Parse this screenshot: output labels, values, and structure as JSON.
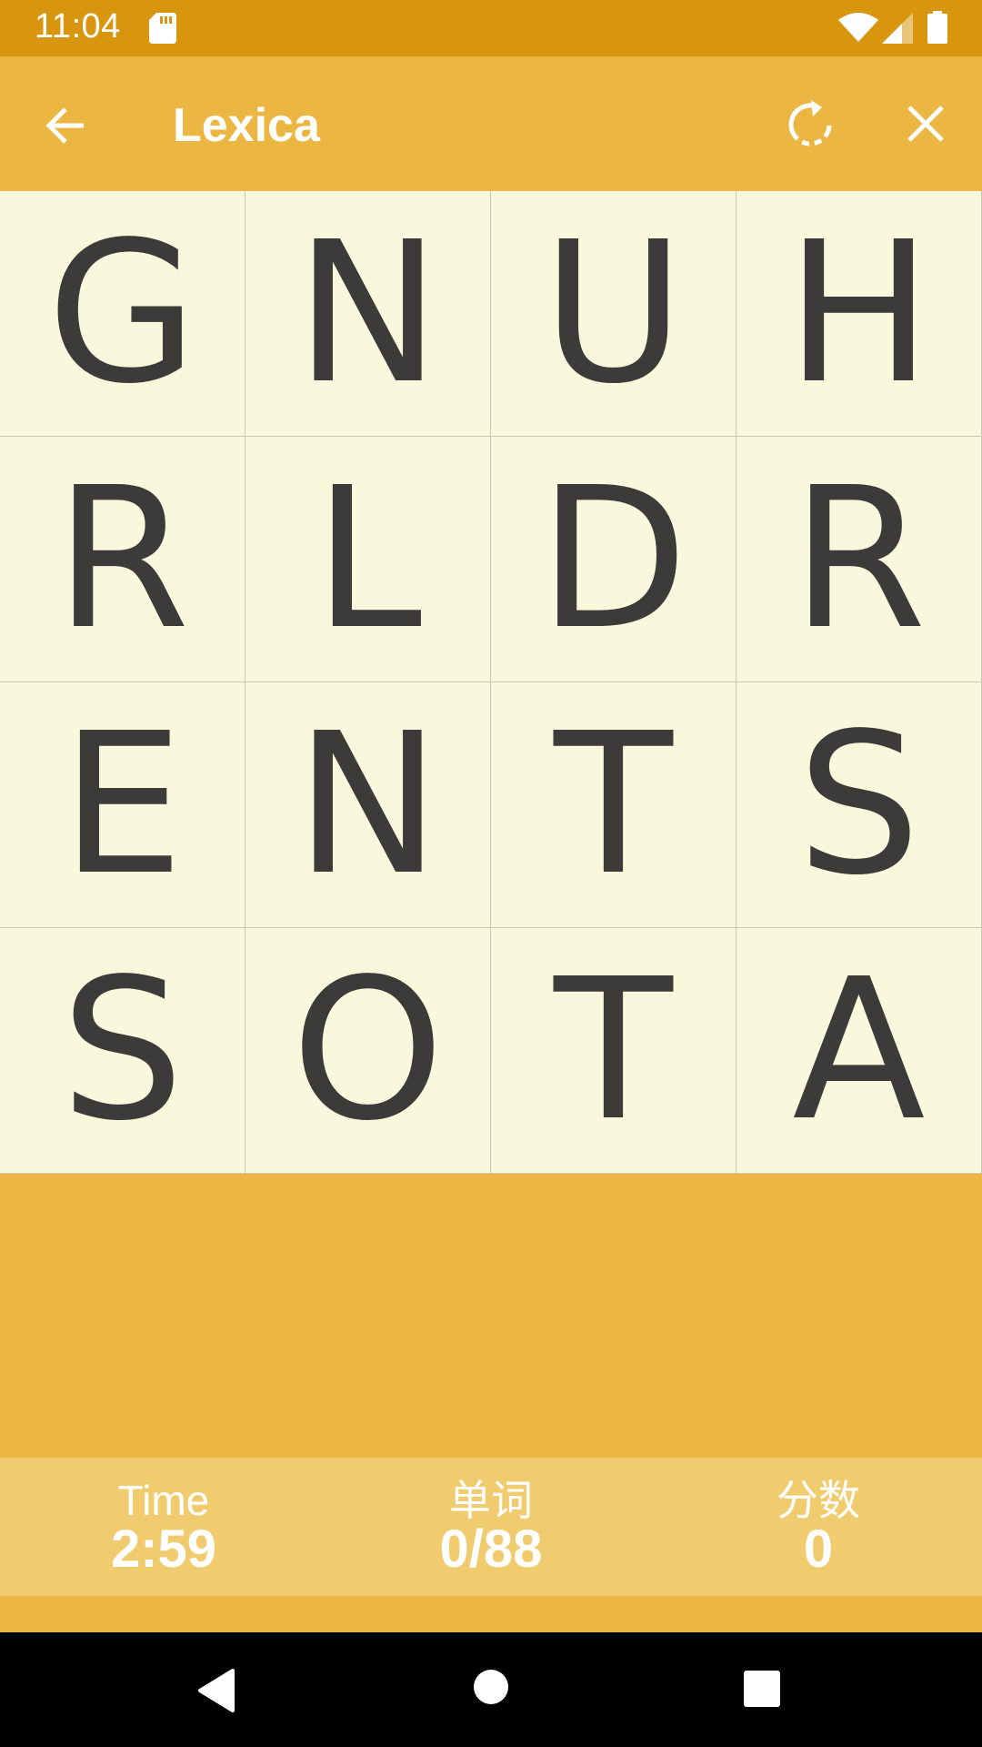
{
  "status_bar": {
    "time": "11:04",
    "icons": [
      "sd-card-icon",
      "wifi-icon",
      "cell-signal-icon",
      "battery-icon"
    ]
  },
  "app_bar": {
    "title": "Lexica",
    "back_icon": "arrow-back-icon",
    "restart_icon": "restart-icon",
    "close_icon": "close-icon"
  },
  "board": {
    "rows": [
      [
        "G",
        "N",
        "U",
        "H"
      ],
      [
        "R",
        "L",
        "D",
        "R"
      ],
      [
        "E",
        "N",
        "T",
        "S"
      ],
      [
        "S",
        "O",
        "T",
        "A"
      ]
    ]
  },
  "stats": {
    "time_label": "Time",
    "time_value": "2:59",
    "words_label": "单词",
    "words_value": "0/88",
    "score_label": "分数",
    "score_value": "0"
  },
  "nav_bar": {
    "icons": [
      "nav-back-icon",
      "nav-home-icon",
      "nav-recents-icon"
    ]
  },
  "colors": {
    "status_bar": "#D8960F",
    "accent": "#ECB642",
    "tile_background": "#F8F8DC",
    "letter": "#3C3B39",
    "stats_bar": "#F0CC6E"
  }
}
